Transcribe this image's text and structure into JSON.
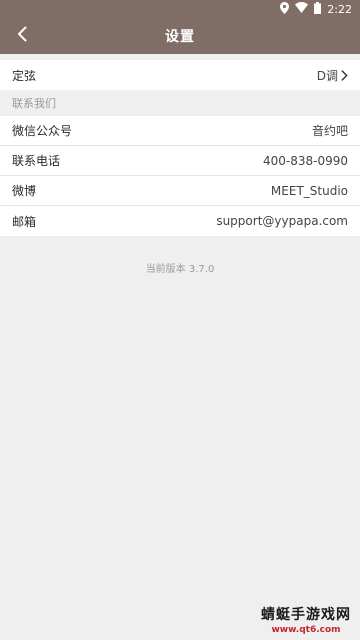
{
  "status_bar": {
    "time": "2:22",
    "icons": [
      "location-icon",
      "wifi-icon",
      "battery-icon"
    ]
  },
  "header": {
    "title": "设置",
    "back_icon": "chevron-left-icon"
  },
  "tuning": {
    "label": "定弦",
    "value": "D调"
  },
  "contact": {
    "section_label": "联系我们",
    "items": [
      {
        "label": "微信公众号",
        "value": "音约吧"
      },
      {
        "label": "联系电话",
        "value": "400-838-0990"
      },
      {
        "label": "微博",
        "value": "MEET_Studio"
      },
      {
        "label": "邮箱",
        "value": "support@yypapa.com"
      }
    ]
  },
  "version_text": "当前版本 3.7.0",
  "watermark": {
    "main": "蜻蜓手游戏网",
    "sub": "www.qt6.com"
  },
  "colors": {
    "header_bg": "#806e66",
    "page_bg": "#efefef"
  }
}
